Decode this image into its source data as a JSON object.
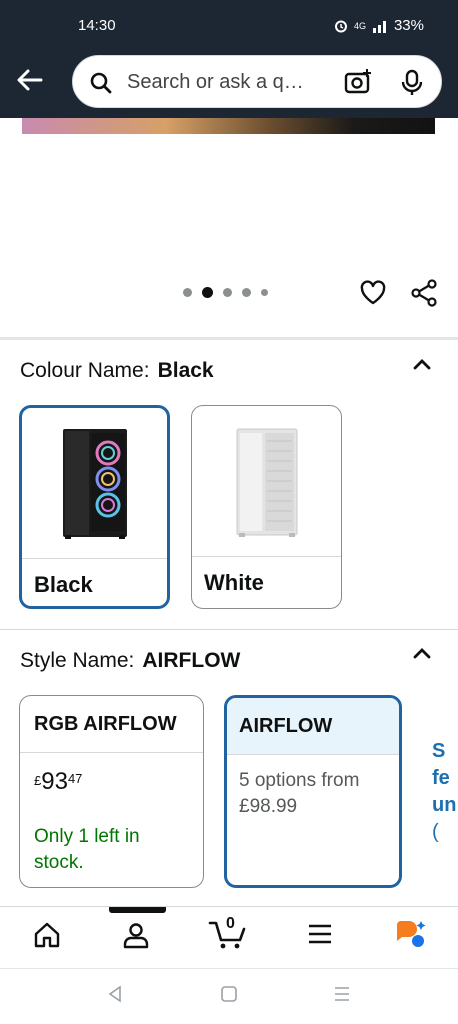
{
  "status_bar": {
    "time": "14:30",
    "network": "4G",
    "battery": "33%"
  },
  "search": {
    "placeholder": "Search or ask a q…"
  },
  "carousel": {
    "dot_count": 5,
    "active_index": 1
  },
  "colour": {
    "label": "Colour Name:",
    "selected": "Black",
    "options": [
      {
        "name": "Black",
        "selected": true
      },
      {
        "name": "White",
        "selected": false
      }
    ]
  },
  "style": {
    "label": "Style Name:",
    "selected": "AIRFLOW",
    "options": [
      {
        "name": "RGB AIRFLOW",
        "price_symbol": "£",
        "price_whole": "93",
        "price_fraction": "47",
        "stock": "Only 1 left in stock.",
        "selected": false
      },
      {
        "name": "AIRFLOW",
        "options_text": "5 options from £98.99",
        "selected": true
      }
    ],
    "peek_text": [
      "S",
      "fe",
      "un",
      "("
    ]
  },
  "bottom_nav": {
    "cart_count": "0"
  },
  "colors": {
    "header_bg": "#1d2733",
    "selected_border": "#2162a1",
    "in_stock": "#007600",
    "selected_head_bg": "#e7f4fb"
  }
}
